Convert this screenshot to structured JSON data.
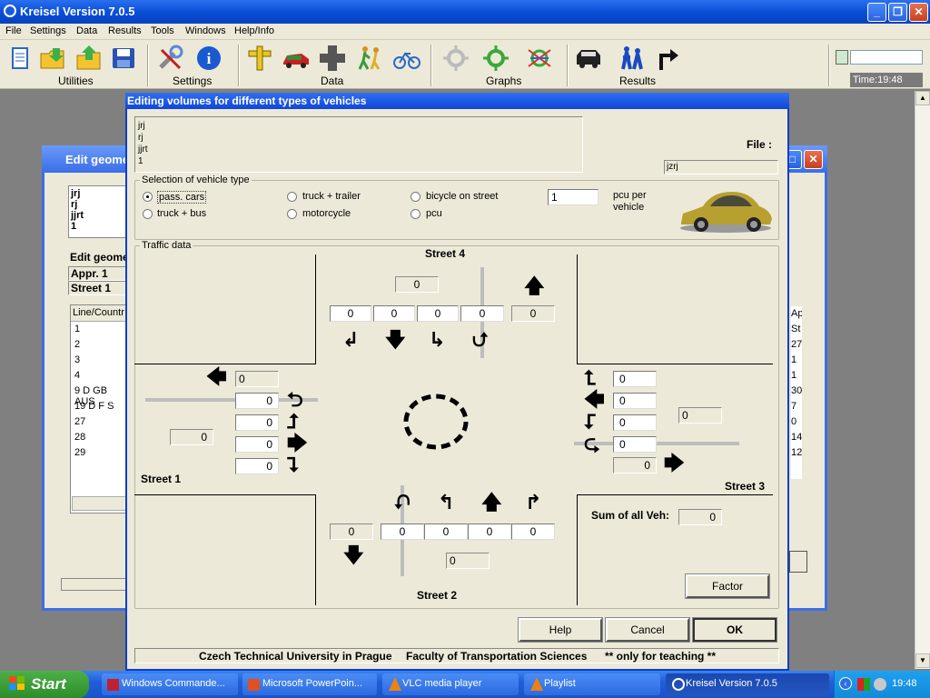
{
  "app": {
    "title": "Kreisel Version 7.0.5"
  },
  "menu": [
    "File",
    "Settings",
    "Data",
    "Results",
    "Tools",
    "Windows",
    "Help/Info"
  ],
  "toolbar": {
    "groups": [
      "Utilities",
      "Settings",
      "Data",
      "Graphs",
      "Results"
    ],
    "clock": "Time:19:48"
  },
  "bg_window": {
    "title": "Edit geome",
    "notes": [
      "jrj",
      "rj",
      "jjrt",
      "1"
    ],
    "section": "Edit geome",
    "appr": "Appr. 1",
    "street": "Street 1",
    "table_header": "Line/Countr",
    "rows": [
      "1",
      "2",
      "3",
      "4",
      "9 D GB AUS",
      "19  D F S",
      "27",
      "28",
      "29"
    ],
    "right_header": "Ap",
    "right_col": [
      "St",
      "27",
      "1",
      "1",
      "30",
      "7",
      "0",
      "14",
      "12"
    ]
  },
  "dialog": {
    "title": "Editing volumes for different types of vehicles",
    "notes": [
      "jrj",
      "rj",
      "jjrt",
      "1"
    ],
    "file_label": "File :",
    "file_value": "jzrj",
    "vehicle_group": "Selection of vehicle type",
    "vehicle_types": [
      {
        "label": "pass. cars",
        "selected": true
      },
      {
        "label": "truck + trailer",
        "selected": false
      },
      {
        "label": "bicycle on street",
        "selected": false
      },
      {
        "label": "truck + bus",
        "selected": false
      },
      {
        "label": "motorcycle",
        "selected": false
      },
      {
        "label": "pcu",
        "selected": false
      }
    ],
    "pcu_value": "1",
    "pcu_label_1": "pcu per",
    "pcu_label_2": "vehicle",
    "traffic_group": "Traffic data",
    "streets": {
      "s1": "Street 1",
      "s2": "Street 2",
      "s3": "Street 3",
      "s4": "Street 4"
    },
    "volumes": {
      "s4_total": "0",
      "s4_in": [
        "0",
        "0",
        "0",
        "0"
      ],
      "s4_out": "0",
      "s1_out": "0",
      "s1_in": [
        "0",
        "0",
        "0",
        "0"
      ],
      "s1_total": "0",
      "s3_in": [
        "0",
        "0",
        "0",
        "0"
      ],
      "s3_total": "0",
      "s3_out": "0",
      "s2_out": "0",
      "s2_in": [
        "0",
        "0",
        "0",
        "0"
      ],
      "s2_total": "0"
    },
    "sum_label": "Sum of all Veh:",
    "sum_value": "0",
    "factor_button": "Factor",
    "help_button": "Help",
    "cancel_button": "Cancel",
    "ok_button": "OK",
    "status_left": "Czech Technical University in Prague",
    "status_mid": "Faculty of Transportation Sciences",
    "status_right": "** only for teaching **"
  },
  "taskbar": {
    "start": "Start",
    "tasks": [
      "Windows Commande...",
      "Microsoft PowerPoin...",
      "VLC media player",
      "Playlist",
      "Kreisel Version 7.0.5"
    ],
    "time": "19:48"
  }
}
